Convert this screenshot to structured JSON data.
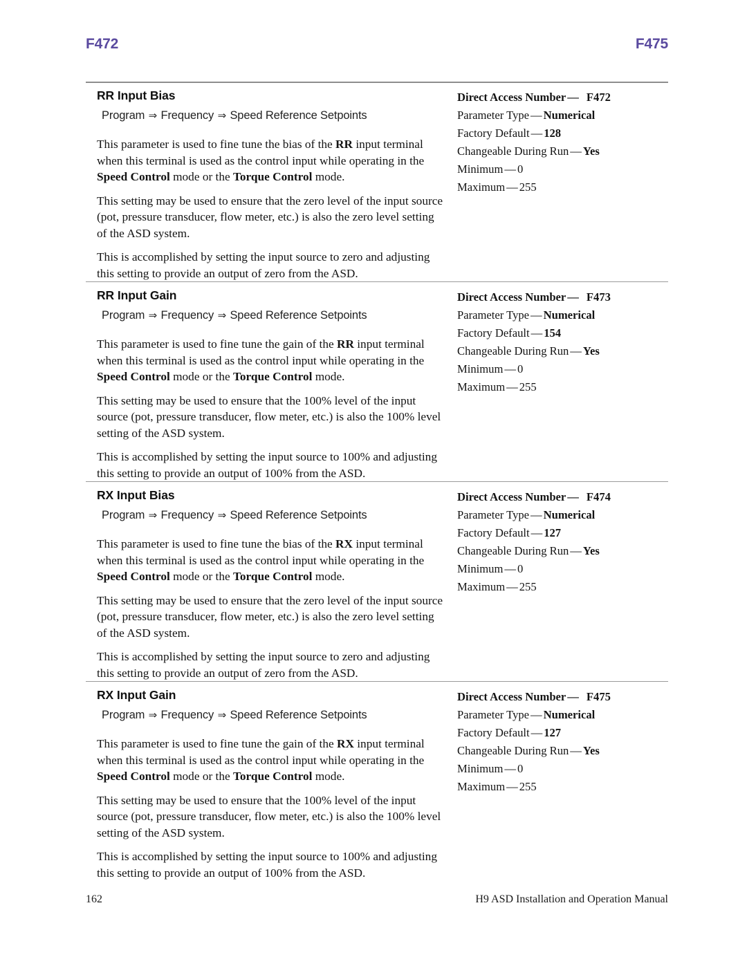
{
  "running_head": {
    "left": "F472",
    "right": "F475",
    "color": "#5a4a9f"
  },
  "footer": {
    "page_number": "162",
    "manual_title": "H9 ASD Installation and Operation Manual"
  },
  "labels": {
    "direct_access_number": "Direct Access Number",
    "parameter_type": "Parameter Type",
    "factory_default": "Factory Default",
    "changeable_during_run": "Changeable During Run",
    "minimum": "Minimum",
    "maximum": "Maximum",
    "dash": "—"
  },
  "nav_path": {
    "p1": "Program",
    "p2": "Frequency",
    "p3": "Speed Reference Setpoints",
    "arrow": "⇒"
  },
  "sections": [
    {
      "title": "RR Input Bias",
      "paragraphs": [
        {
          "runs": [
            {
              "t": "This parameter is used to fine tune the bias of the ",
              "b": false
            },
            {
              "t": "RR",
              "b": true
            },
            {
              "t": " input terminal when this terminal is used as the control input while operating in the ",
              "b": false
            },
            {
              "t": "Speed Control",
              "b": true
            },
            {
              "t": " mode or the ",
              "b": false
            },
            {
              "t": "Torque Control",
              "b": true
            },
            {
              "t": " mode.",
              "b": false
            }
          ]
        },
        {
          "runs": [
            {
              "t": "This setting may be used to ensure that the zero level of the input source (pot, pressure transducer, flow meter, etc.) is also the zero level setting of the ASD system.",
              "b": false
            }
          ]
        },
        {
          "runs": [
            {
              "t": "This is accomplished by setting the input source to zero and adjusting this setting to provide an output of zero from the ASD.",
              "b": false
            }
          ]
        }
      ],
      "meta": {
        "direct_access_number": "F472",
        "parameter_type": "Numerical",
        "factory_default": "128",
        "changeable_during_run": "Yes",
        "minimum": "0",
        "maximum": "255"
      }
    },
    {
      "title": "RR Input Gain",
      "paragraphs": [
        {
          "runs": [
            {
              "t": "This parameter is used to fine tune the gain of the ",
              "b": false
            },
            {
              "t": "RR",
              "b": true
            },
            {
              "t": " input terminal when this terminal is used as the control input while operating in the ",
              "b": false
            },
            {
              "t": "Speed Control",
              "b": true
            },
            {
              "t": " mode or the ",
              "b": false
            },
            {
              "t": "Torque Control",
              "b": true
            },
            {
              "t": " mode.",
              "b": false
            }
          ]
        },
        {
          "runs": [
            {
              "t": "This setting may be used to ensure that the 100% level of the input source (pot, pressure transducer, flow meter, etc.) is also the 100% level setting of the ASD system.",
              "b": false
            }
          ]
        },
        {
          "runs": [
            {
              "t": "This is accomplished by setting the input source to 100% and adjusting this setting to provide an output of 100% from the ASD.",
              "b": false
            }
          ]
        }
      ],
      "meta": {
        "direct_access_number": "F473",
        "parameter_type": "Numerical",
        "factory_default": "154",
        "changeable_during_run": "Yes",
        "minimum": "0",
        "maximum": "255"
      }
    },
    {
      "title": "RX Input Bias",
      "paragraphs": [
        {
          "runs": [
            {
              "t": "This parameter is used to fine tune the bias of the ",
              "b": false
            },
            {
              "t": "RX",
              "b": true
            },
            {
              "t": " input terminal when this terminal is used as the control input while operating in the ",
              "b": false
            },
            {
              "t": "Speed Control",
              "b": true
            },
            {
              "t": " mode or the ",
              "b": false
            },
            {
              "t": "Torque Control",
              "b": true
            },
            {
              "t": " mode.",
              "b": false
            }
          ]
        },
        {
          "runs": [
            {
              "t": "This setting may be used to ensure that the zero level of the input source (pot, pressure transducer, flow meter, etc.) is also the zero level setting of the ASD system.",
              "b": false
            }
          ]
        },
        {
          "runs": [
            {
              "t": "This is accomplished by setting the input source to zero and adjusting this setting to provide an output of zero from the ASD.",
              "b": false
            }
          ]
        }
      ],
      "meta": {
        "direct_access_number": "F474",
        "parameter_type": "Numerical",
        "factory_default": "127",
        "changeable_during_run": "Yes",
        "minimum": "0",
        "maximum": "255"
      }
    },
    {
      "title": "RX Input Gain",
      "paragraphs": [
        {
          "runs": [
            {
              "t": "This parameter is used to fine tune the gain of the ",
              "b": false
            },
            {
              "t": "RX",
              "b": true
            },
            {
              "t": " input terminal when this terminal is used as the control input while operating in the ",
              "b": false
            },
            {
              "t": "Speed Control",
              "b": true
            },
            {
              "t": " mode or the ",
              "b": false
            },
            {
              "t": "Torque Control",
              "b": true
            },
            {
              "t": " mode.",
              "b": false
            }
          ]
        },
        {
          "runs": [
            {
              "t": "This setting may be used to ensure that the 100% level of the input source (pot, pressure transducer, flow meter, etc.) is also the 100% level setting of the ASD system.",
              "b": false
            }
          ]
        },
        {
          "runs": [
            {
              "t": "This is accomplished by setting the input source to 100% and adjusting this setting to provide an output of 100% from the ASD.",
              "b": false
            }
          ]
        }
      ],
      "meta": {
        "direct_access_number": "F475",
        "parameter_type": "Numerical",
        "factory_default": "127",
        "changeable_during_run": "Yes",
        "minimum": "0",
        "maximum": "255"
      }
    }
  ]
}
